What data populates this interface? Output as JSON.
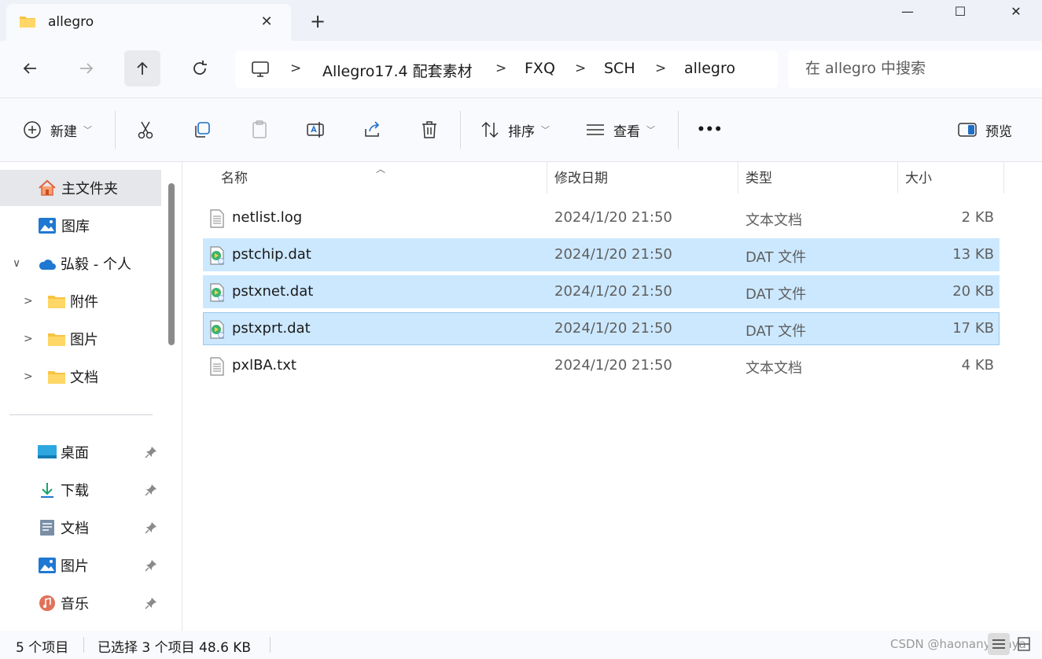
{
  "tab": {
    "title": "allegro"
  },
  "window": {
    "minimize": "—",
    "maximize": "☐",
    "close": "✕"
  },
  "nav": {
    "breadcrumbs": [
      "Allegro17.4 配套素材",
      "FXQ",
      "SCH",
      "allegro"
    ],
    "search_placeholder": "在 allegro 中搜索"
  },
  "toolbar": {
    "new_label": "新建",
    "sort_label": "排序",
    "view_label": "查看",
    "more_label": "•••",
    "preview_label": "预览"
  },
  "sidebar": {
    "home": "主文件夹",
    "gallery": "图库",
    "onedrive": "弘毅 - 个人",
    "folders": [
      "附件",
      "图片",
      "文档"
    ],
    "quick": [
      "桌面",
      "下载",
      "文档",
      "图片",
      "音乐"
    ]
  },
  "columns": {
    "name": "名称",
    "modified": "修改日期",
    "type": "类型",
    "size": "大小"
  },
  "files": [
    {
      "name": "netlist.log",
      "modified": "2024/1/20 21:50",
      "type": "文本文档",
      "size": "2 KB",
      "selected": false,
      "icon": "text-file-icon"
    },
    {
      "name": "pstchip.dat",
      "modified": "2024/1/20 21:50",
      "type": "DAT 文件",
      "size": "13 KB",
      "selected": true,
      "icon": "dat-file-icon"
    },
    {
      "name": "pstxnet.dat",
      "modified": "2024/1/20 21:50",
      "type": "DAT 文件",
      "size": "20 KB",
      "selected": true,
      "icon": "dat-file-icon"
    },
    {
      "name": "pstxprt.dat",
      "modified": "2024/1/20 21:50",
      "type": "DAT 文件",
      "size": "17 KB",
      "selected": true,
      "icon": "dat-file-icon"
    },
    {
      "name": "pxlBA.txt",
      "modified": "2024/1/20 21:50",
      "type": "文本文档",
      "size": "4 KB",
      "selected": false,
      "icon": "text-file-icon"
    }
  ],
  "status": {
    "count": "5 个项目",
    "selection": "已选择 3 个项目  48.6 KB",
    "watermark": "CSDN @haonanyayaya"
  },
  "colors": {
    "selection": "#cce8ff",
    "focus_border": "#99c9ef",
    "folder": "#f6c343"
  }
}
